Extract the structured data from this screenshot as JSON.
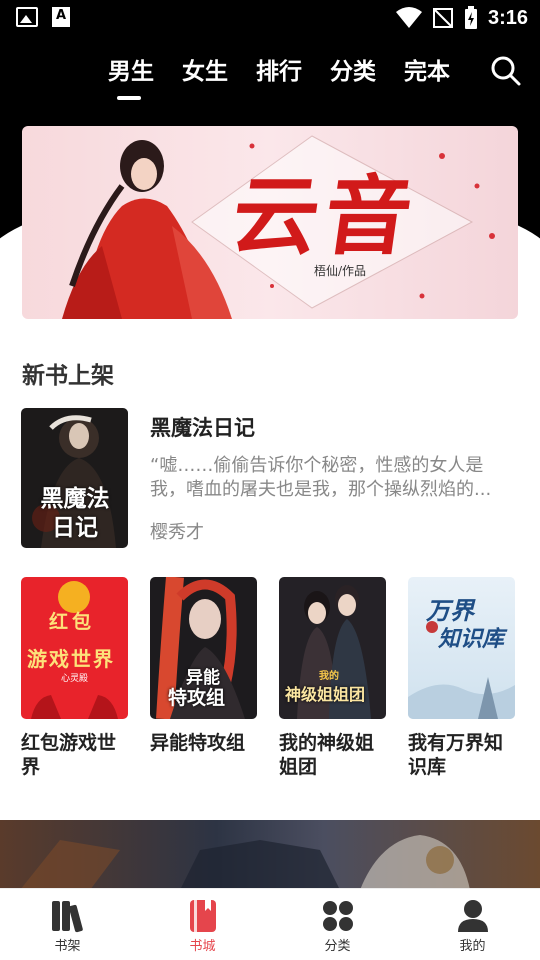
{
  "status_bar": {
    "time": "3:16",
    "left_icons": [
      "image-notification-icon",
      "font-notification-icon"
    ],
    "right_icons": [
      "wifi-icon",
      "no-signal-icon",
      "battery-charging-icon"
    ]
  },
  "top_tabs": [
    {
      "label": "男生",
      "active": true
    },
    {
      "label": "女生",
      "active": false
    },
    {
      "label": "排行",
      "active": false
    },
    {
      "label": "分类",
      "active": false
    },
    {
      "label": "完本",
      "active": false
    }
  ],
  "banner": {
    "title": "云音",
    "author": "梧仙/作品"
  },
  "section": {
    "title": "新书上架"
  },
  "featured_book": {
    "title": "黑魔法日记",
    "desc_line1": "“嘘……偷偷告诉你个秘密，性感的女人是",
    "desc_line2": "我，嗜血的屠夫也是我，那个操纵烈焰的...",
    "author": "樱秀才",
    "cover_text": "黑魔法日记"
  },
  "books": [
    {
      "title": "红包游戏世界",
      "cover_text_1": "红包",
      "cover_text_2": "游戏世界",
      "cover_author": "心灵殿"
    },
    {
      "title": "异能特攻组",
      "cover_text_1": "异能",
      "cover_text_2": "特攻组"
    },
    {
      "title": "我的神级姐姐团",
      "cover_text_1": "我的",
      "cover_text_2": "神级姐姐团"
    },
    {
      "title": "我有万界知识库",
      "cover_text_1": "万界",
      "cover_text_2": "知识库"
    }
  ],
  "bottom_nav": [
    {
      "label": "书架",
      "icon": "bookshelf-icon",
      "active": false
    },
    {
      "label": "书城",
      "icon": "bookstore-icon",
      "active": true
    },
    {
      "label": "分类",
      "icon": "category-icon",
      "active": false
    },
    {
      "label": "我的",
      "icon": "profile-icon",
      "active": false
    }
  ],
  "colors": {
    "accent": "#e5454c",
    "header_bg": "#000000",
    "secondary_text": "#888888"
  }
}
